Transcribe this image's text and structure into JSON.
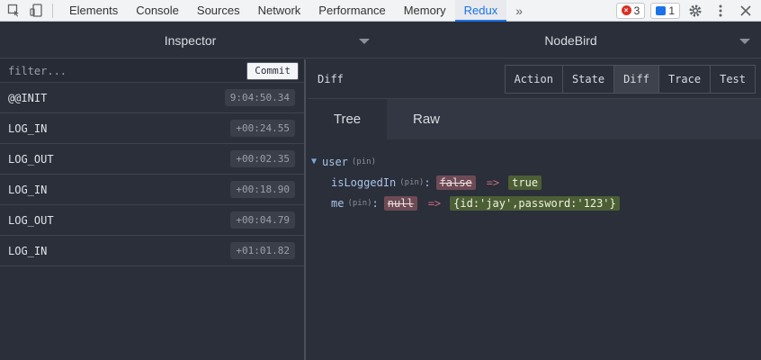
{
  "devtools": {
    "tabs": [
      {
        "label": "Elements",
        "active": false
      },
      {
        "label": "Console",
        "active": false
      },
      {
        "label": "Sources",
        "active": false
      },
      {
        "label": "Network",
        "active": false
      },
      {
        "label": "Performance",
        "active": false
      },
      {
        "label": "Memory",
        "active": false
      },
      {
        "label": "Redux",
        "active": true
      }
    ],
    "more": "»",
    "errors_count": "3",
    "messages_count": "1"
  },
  "header": {
    "left_select": "Inspector",
    "right_select": "NodeBird"
  },
  "left": {
    "filter_placeholder": "filter...",
    "commit_label": "Commit",
    "actions": [
      {
        "name": "@@INIT",
        "time": "9:04:50.34"
      },
      {
        "name": "LOG_IN",
        "time": "+00:24.55"
      },
      {
        "name": "LOG_OUT",
        "time": "+00:02.35"
      },
      {
        "name": "LOG_IN",
        "time": "+00:18.90"
      },
      {
        "name": "LOG_OUT",
        "time": "+00:04.79"
      },
      {
        "name": "LOG_IN",
        "time": "+01:01.82"
      }
    ]
  },
  "right": {
    "title": "Diff",
    "buttons": [
      {
        "label": "Action",
        "active": false
      },
      {
        "label": "State",
        "active": false
      },
      {
        "label": "Diff",
        "active": true
      },
      {
        "label": "Trace",
        "active": false
      },
      {
        "label": "Test",
        "active": false
      }
    ],
    "subtabs": [
      {
        "label": "Tree",
        "active": true
      },
      {
        "label": "Raw",
        "active": false
      }
    ],
    "tree": {
      "root_key": "user",
      "pin": "(pin)",
      "items": [
        {
          "key": "isLoggedIn",
          "old": "false",
          "new": "true"
        },
        {
          "key": "me",
          "old": "null",
          "new": "{id:'jay',password:'123'}"
        }
      ],
      "arrow": "=>"
    }
  }
}
